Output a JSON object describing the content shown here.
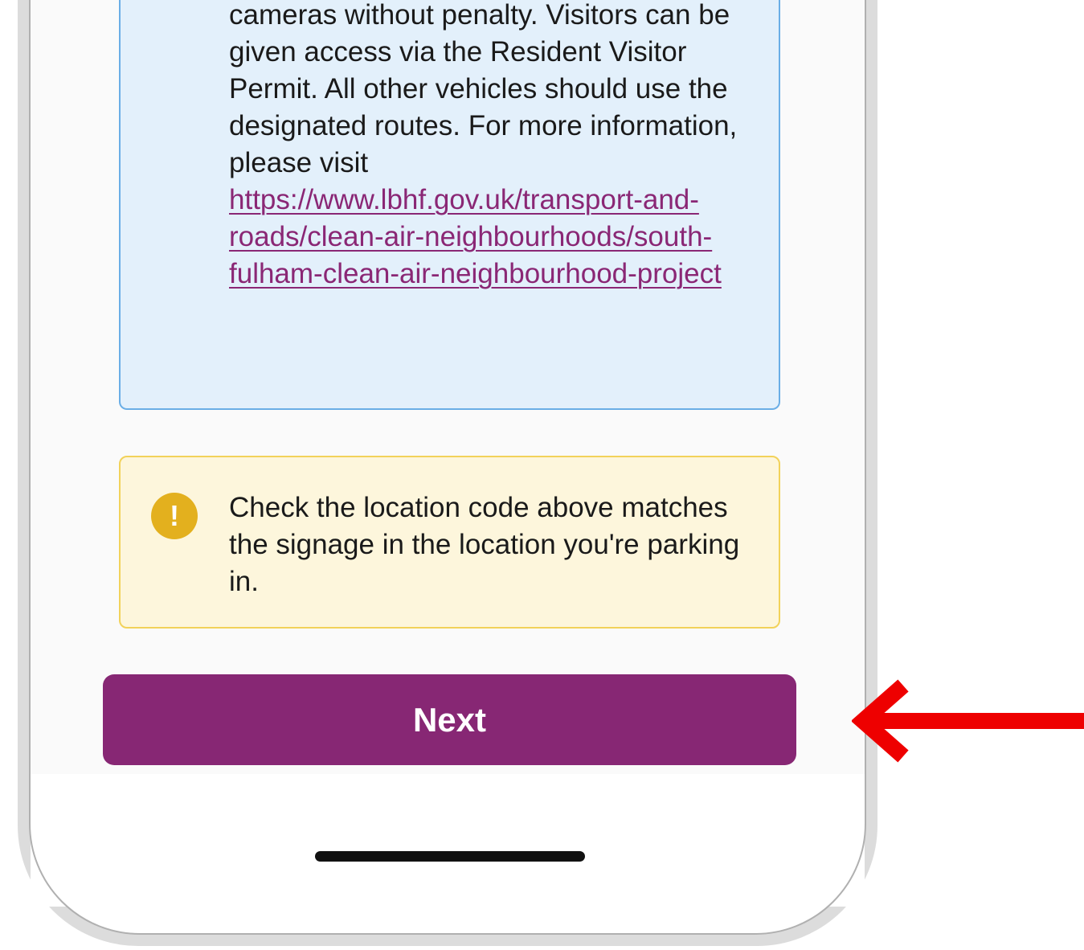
{
  "info_box": {
    "text": "cameras without penalty. Visitors can be given access via the Resident Visitor Permit. All other vehicles should use the designated routes. For more information, please visit",
    "link": "https://www.lbhf.gov.uk/transport-and-roads/clean-air-neighbourhoods/south-fulham-clean-air-neighbourhood-project"
  },
  "warning": {
    "icon": "exclamation-circle-icon",
    "icon_glyph": "!",
    "text": "Check the location code above matches the signage in the location you're parking in."
  },
  "next_button": {
    "label": "Next"
  },
  "annotation": {
    "arrow_color": "#ee0000"
  },
  "colors": {
    "brand_purple": "#872774",
    "info_background": "#e3f0fb",
    "info_border": "#6aaee6",
    "warning_background": "#fdf6dc",
    "warning_border": "#f2d25a",
    "warning_icon": "#e3b01e",
    "link": "#8a2775"
  }
}
